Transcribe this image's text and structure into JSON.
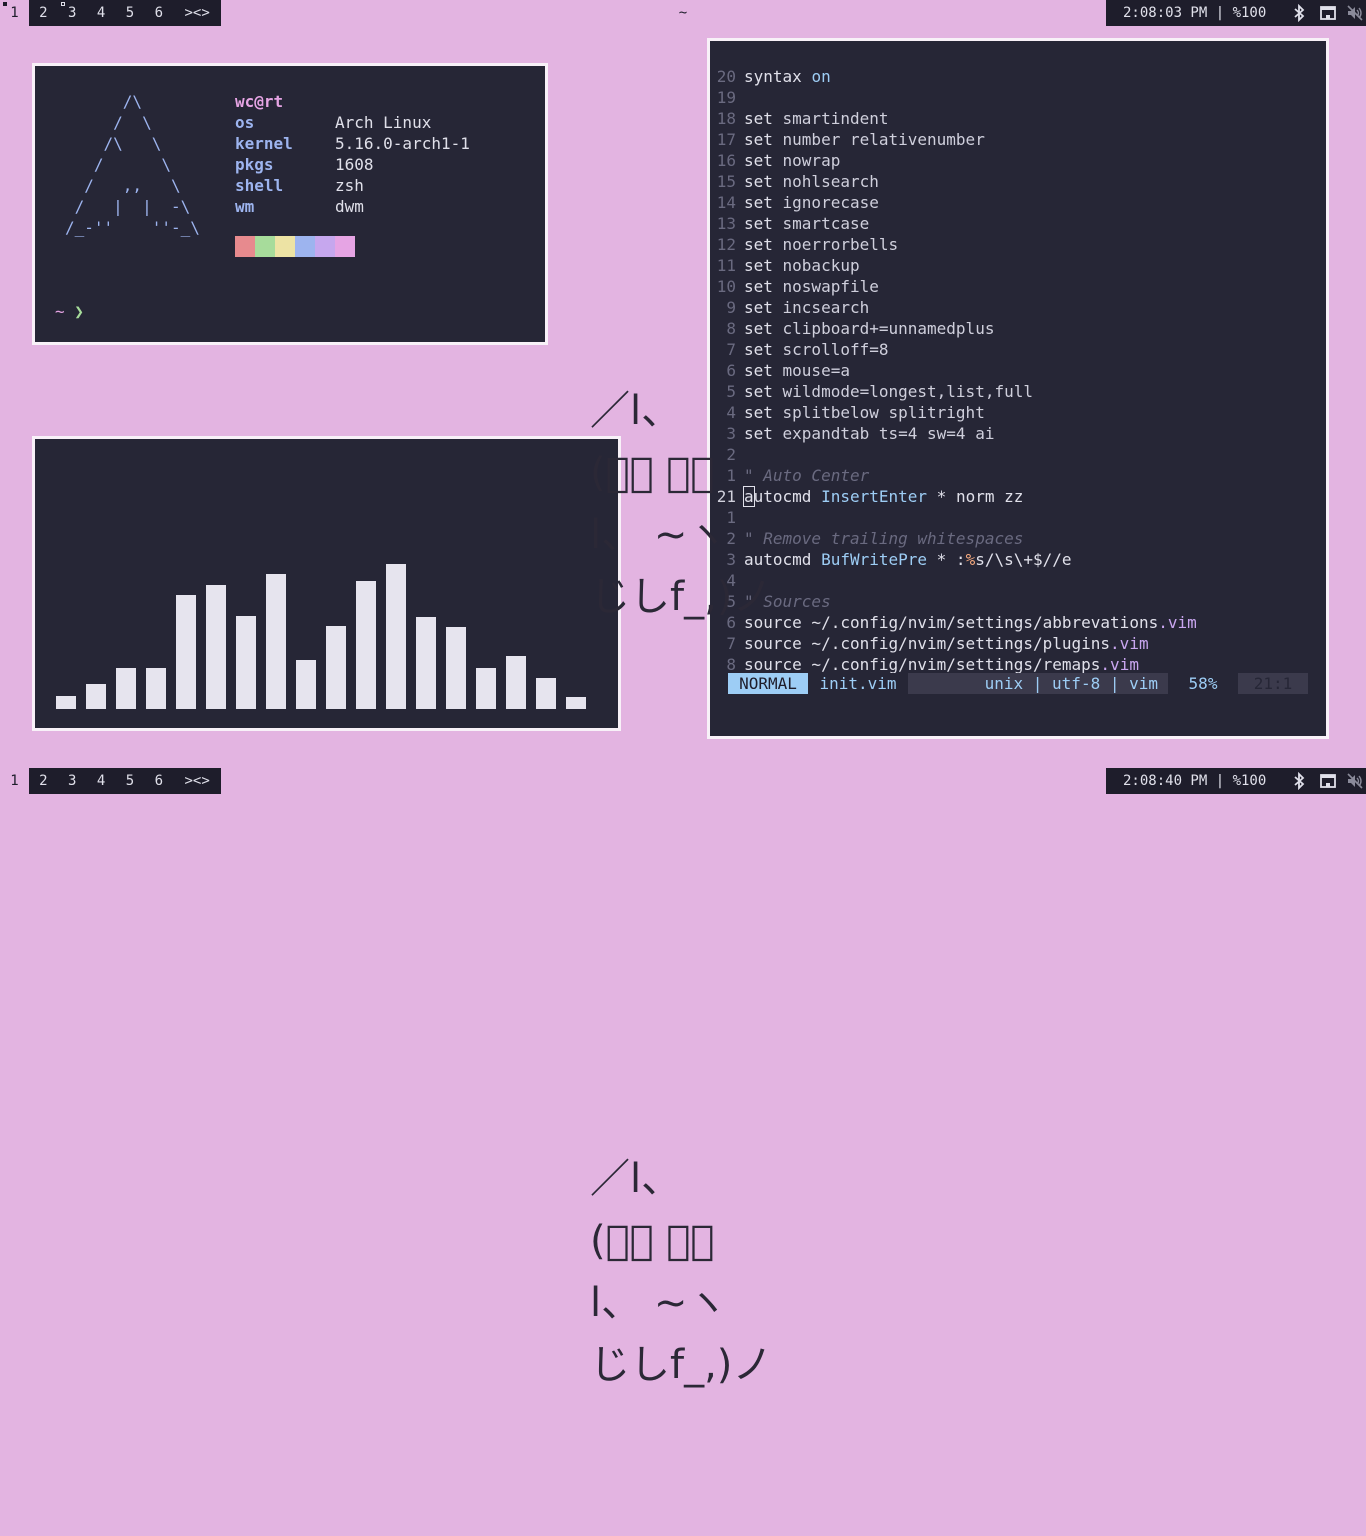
{
  "bars": [
    {
      "tags": [
        "1",
        "2",
        "3",
        "4",
        "5",
        "6"
      ],
      "layout": "><>",
      "title": "~",
      "status": "2:08:03 PM | %100"
    },
    {
      "tags": [
        "1",
        "2",
        "3",
        "4",
        "5",
        "6"
      ],
      "layout": "><>",
      "title": "",
      "status": "2:08:40 PM | %100"
    }
  ],
  "fetch": {
    "logo": "      /\\\n     /  \\\n    /\\   \\\n   /      \\\n  /   ,,   \\\n /   |  |  -\\\n/_-''    ''-_\\",
    "user": "wc@rt",
    "rows": [
      {
        "key": "os",
        "val": "Arch Linux"
      },
      {
        "key": "kernel",
        "val": "5.16.0-arch1-1"
      },
      {
        "key": "pkgs",
        "val": "1608"
      },
      {
        "key": "shell",
        "val": "zsh"
      },
      {
        "key": "wm",
        "val": "dwm"
      }
    ],
    "palette": [
      "#e78a8e",
      "#a7dc9b",
      "#ede3a4",
      "#9db4ef",
      "#c6a7ee",
      "#e6a4e4"
    ],
    "prompt": "~",
    "prompt_arrow": "❯"
  },
  "visualizer": {
    "bar_color": "#e6e4ee",
    "levels": [
      0.1,
      0.19,
      0.32,
      0.32,
      0.88,
      0.96,
      0.72,
      1.04,
      0.38,
      0.64,
      0.99,
      1.12,
      0.71,
      0.63,
      0.32,
      0.41,
      0.24,
      0.09
    ]
  },
  "vim": {
    "lines": [
      {
        "n": "20",
        "parts": [
          [
            "k",
            "syntax "
          ],
          [
            "kw",
            "on"
          ]
        ]
      },
      {
        "n": "19",
        "parts": []
      },
      {
        "n": "18",
        "parts": [
          [
            "k",
            "set "
          ],
          [
            "t",
            "smartindent"
          ]
        ]
      },
      {
        "n": "17",
        "parts": [
          [
            "k",
            "set "
          ],
          [
            "t",
            "number relativenumber"
          ]
        ]
      },
      {
        "n": "16",
        "parts": [
          [
            "k",
            "set "
          ],
          [
            "t",
            "nowrap"
          ]
        ]
      },
      {
        "n": "15",
        "parts": [
          [
            "k",
            "set "
          ],
          [
            "t",
            "nohlsearch"
          ]
        ]
      },
      {
        "n": "14",
        "parts": [
          [
            "k",
            "set "
          ],
          [
            "t",
            "ignorecase"
          ]
        ]
      },
      {
        "n": "13",
        "parts": [
          [
            "k",
            "set "
          ],
          [
            "t",
            "smartcase"
          ]
        ]
      },
      {
        "n": "12",
        "parts": [
          [
            "k",
            "set "
          ],
          [
            "t",
            "noerrorbells"
          ]
        ]
      },
      {
        "n": "11",
        "parts": [
          [
            "k",
            "set "
          ],
          [
            "t",
            "nobackup"
          ]
        ]
      },
      {
        "n": "10",
        "parts": [
          [
            "k",
            "set "
          ],
          [
            "t",
            "noswapfile"
          ]
        ]
      },
      {
        "n": "9",
        "parts": [
          [
            "k",
            "set "
          ],
          [
            "t",
            "incsearch"
          ]
        ]
      },
      {
        "n": "8",
        "parts": [
          [
            "k",
            "set "
          ],
          [
            "t",
            "clipboard+=unnamedplus"
          ]
        ]
      },
      {
        "n": "7",
        "parts": [
          [
            "k",
            "set "
          ],
          [
            "t",
            "scrolloff=8"
          ]
        ]
      },
      {
        "n": "6",
        "parts": [
          [
            "k",
            "set "
          ],
          [
            "t",
            "mouse=a"
          ]
        ]
      },
      {
        "n": "5",
        "parts": [
          [
            "k",
            "set "
          ],
          [
            "t",
            "wildmode=longest,list,full"
          ]
        ]
      },
      {
        "n": "4",
        "parts": [
          [
            "k",
            "set "
          ],
          [
            "t",
            "splitbelow splitright"
          ]
        ]
      },
      {
        "n": "3",
        "parts": [
          [
            "k",
            "set "
          ],
          [
            "t",
            "expandtab ts=4 sw=4 ai"
          ]
        ]
      },
      {
        "n": "2",
        "parts": []
      },
      {
        "n": "1",
        "parts": [
          [
            "cm",
            "\" Auto Center"
          ]
        ]
      },
      {
        "n": "21",
        "cursor": true,
        "parts": [
          [
            "k",
            "autocmd "
          ],
          [
            "kw",
            "InsertEnter"
          ],
          [
            "k",
            " * norm zz"
          ]
        ]
      },
      {
        "n": "1",
        "parts": []
      },
      {
        "n": "2",
        "parts": [
          [
            "cm",
            "\" Remove trailing whitespaces"
          ]
        ]
      },
      {
        "n": "3",
        "parts": [
          [
            "k",
            "autocmd "
          ],
          [
            "kw",
            "BufWritePre"
          ],
          [
            "k",
            " * :"
          ],
          [
            "or",
            "%"
          ],
          [
            "k",
            "s/\\s\\+$//e"
          ]
        ]
      },
      {
        "n": "4",
        "parts": []
      },
      {
        "n": "5",
        "parts": [
          [
            "cm",
            "\" Sources"
          ]
        ]
      },
      {
        "n": "6",
        "parts": [
          [
            "k",
            "source ~/.config/nvim/settings/abbrevations"
          ],
          [
            "vio",
            ".vim"
          ]
        ]
      },
      {
        "n": "7",
        "parts": [
          [
            "k",
            "source ~/.config/nvim/settings/plugins"
          ],
          [
            "vio",
            ".vim"
          ]
        ]
      },
      {
        "n": "8",
        "parts": [
          [
            "k",
            "source ~/.config/nvim/settings/remaps"
          ],
          [
            "vio",
            ".vim"
          ]
        ]
      }
    ],
    "status": {
      "mode": "NORMAL",
      "file": "init.vim",
      "format": "unix | utf-8 | vim",
      "percent": "58%",
      "position": "21:1"
    }
  },
  "kaomoji": "／l、\n(ﾟ､ ｡７\nl、 ~ヽ\nじしf_,)ノ"
}
